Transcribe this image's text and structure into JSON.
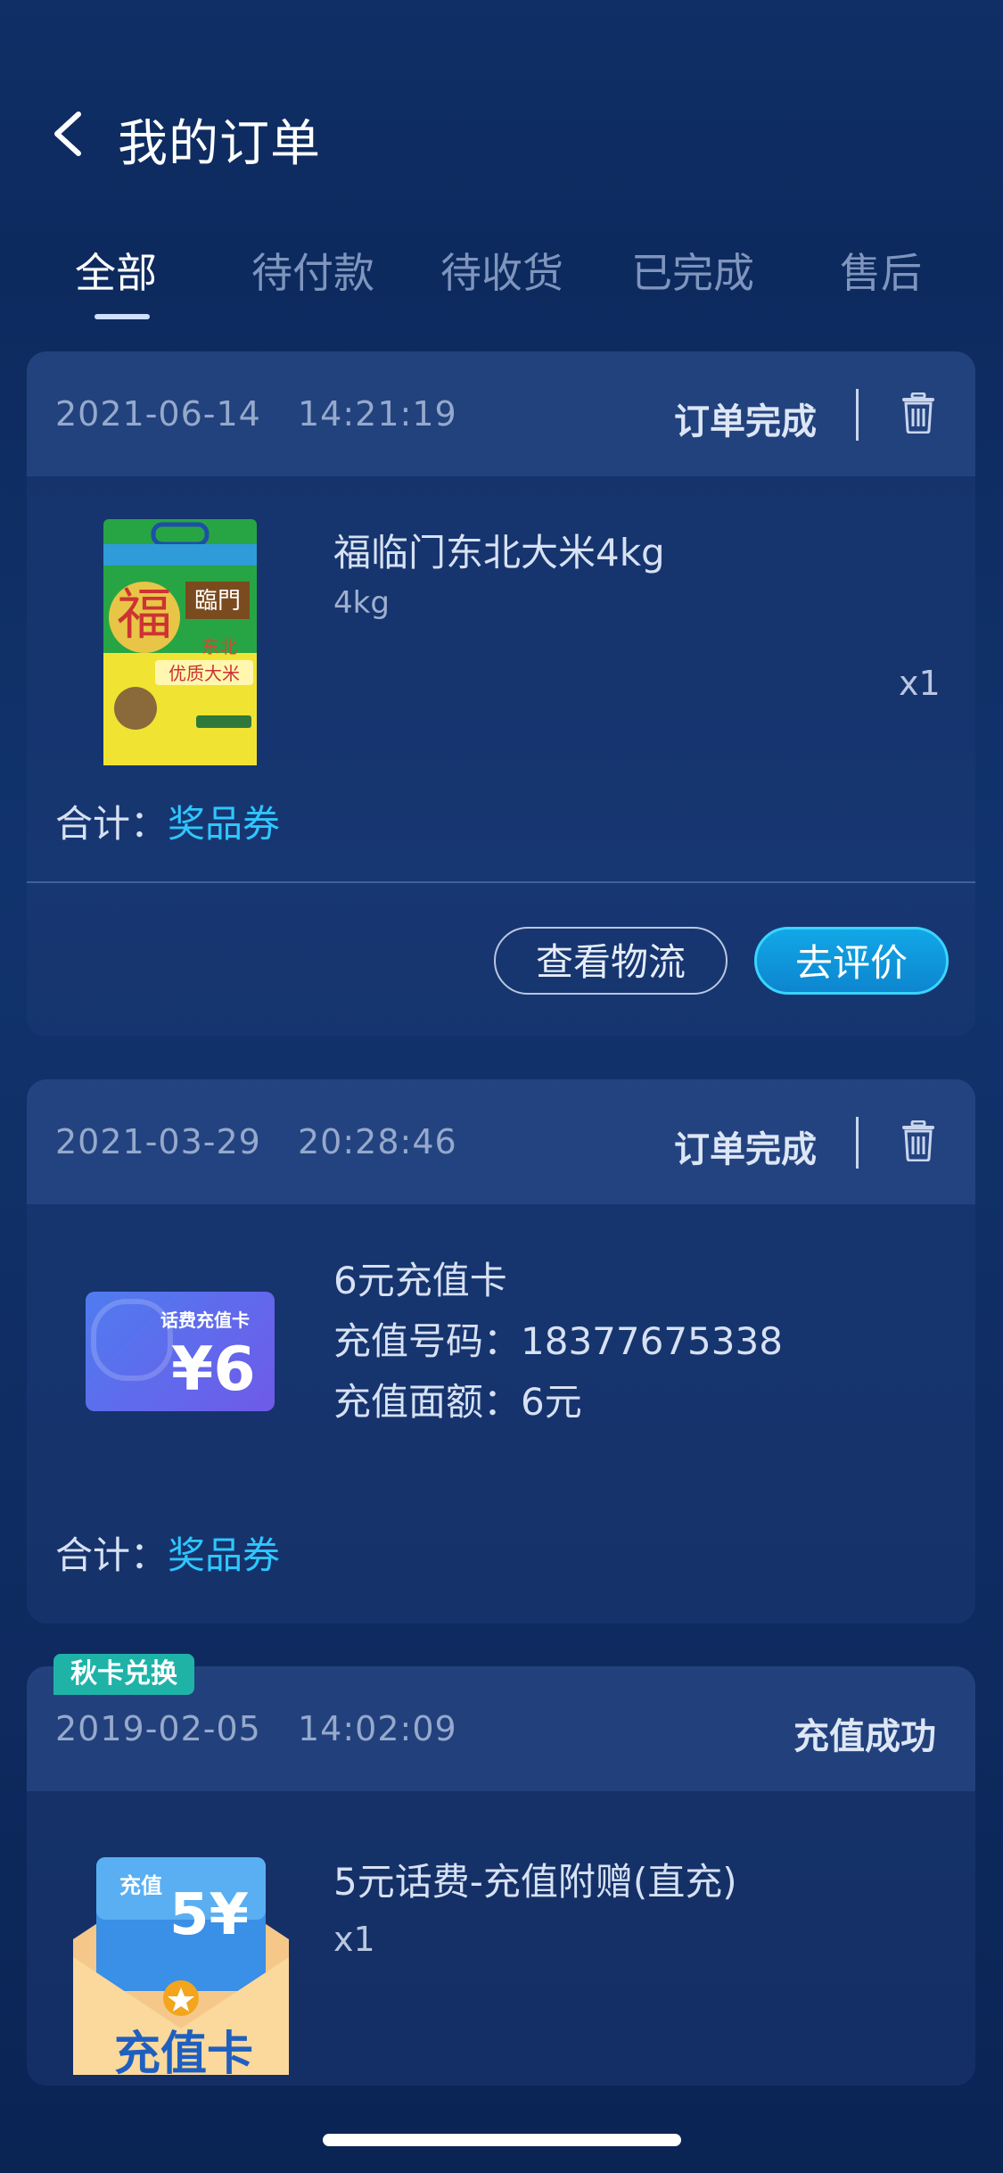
{
  "header": {
    "title": "我的订单"
  },
  "tabs": [
    {
      "label": "全部",
      "active": true
    },
    {
      "label": "待付款",
      "active": false
    },
    {
      "label": "待收货",
      "active": false
    },
    {
      "label": "已完成",
      "active": false
    },
    {
      "label": "售后",
      "active": false
    }
  ],
  "orders": [
    {
      "date": "2021-06-14",
      "time": "14:21:19",
      "status": "订单完成",
      "product_name": "福临门东北大米4kg",
      "product_spec": "4kg",
      "quantity": "x1",
      "total_label": "合计：",
      "total_value": "奖品券",
      "actions": [
        "查看物流",
        "去评价"
      ]
    },
    {
      "date": "2021-03-29",
      "time": "20:28:46",
      "status": "订单完成",
      "product_name": "6元充值卡",
      "recharge_number": "充值号码：18377675338",
      "recharge_amount": "充值面额：6元",
      "thumb_caption": "话费充值卡",
      "thumb_value": "¥6",
      "total_label": "合计：",
      "total_value": "奖品券"
    },
    {
      "badge": "秋卡兑换",
      "date": "2019-02-05",
      "time": "14:02:09",
      "status": "充值成功",
      "product_name": "5元话费-充值附赠(直充)",
      "quantity": "x1",
      "thumb_top": "充值",
      "thumb_value": "5¥",
      "thumb_label": "充值卡"
    }
  ],
  "colors": {
    "accent": "#2fc6ff",
    "badge": "#1fb3a8",
    "primary_button": "#0d86cf"
  }
}
